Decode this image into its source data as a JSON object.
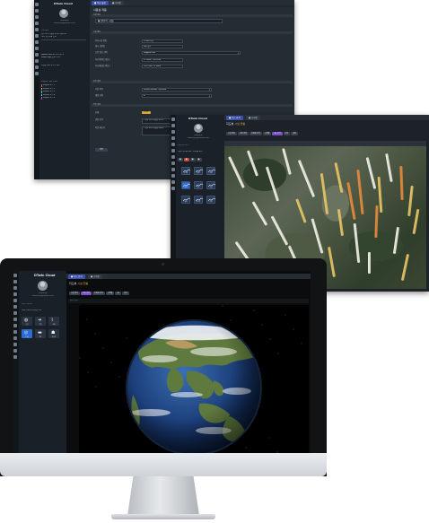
{
  "brand": "DTwin Cloud",
  "user": {
    "name": "슈퍼어드민",
    "email": "admin@digitaltwin.com"
  },
  "settings_window": {
    "tabs": [
      {
        "label": "■ 주요 설정",
        "active": true
      },
      {
        "label": "■ 조직정",
        "active": false
      }
    ],
    "page_title": "사용설 적용",
    "section_top": "기본 정보",
    "tenant_name": "■ 실증분석 시설물",
    "sidebar_section_1": "최근 활동",
    "sidebar_lines_1": [
      "실증 분석 시설물 데이터 업데이트",
      "배치 작업 완료 알림"
    ],
    "sidebar_lines_2": [
      "Spatial Data 동기화 진행 중",
      "Model Map 업로드 대기",
      "시설물 점검 보고서 생성"
    ],
    "sidebar_section_2": "Project / Site Links",
    "sidebar_links": [
      "Project 링크 1",
      "Project 링크 2",
      "Project 링크 3",
      "Project 링크 4",
      "Project 링크 5"
    ],
    "section_1": "시설 정보",
    "fields_1": [
      {
        "label": "주요시설 명칭",
        "value": "DTWin 시설"
      },
      {
        "label": "예시 설정값",
        "value": "sub 설정"
      },
      {
        "label": "공간 정보 선택",
        "value": "Mapped Grid"
      },
      {
        "label": "좌표계(위도/경도)",
        "value": "37.5665, 126.9780"
      },
      {
        "label": "좌표계(경도/위도)",
        "value": "126.9780, 37.5665"
      }
    ],
    "section_2": "출력 설정",
    "fields_2": [
      {
        "label": "측정 항목",
        "value": "Sensor Monitor Overview"
      },
      {
        "label": "레벨 단위",
        "value": "kl"
      }
    ],
    "section_3": "작업 설정",
    "fields_3": [
      {
        "label": "상태",
        "value": "진행중"
      },
      {
        "label": "관련 문서",
        "value": "• 실증 분석 시설물 보고서"
      },
      {
        "label": "작업 메시지",
        "value": "• 실증 분석 시설물 데이터"
      }
    ],
    "save_label": "확인"
  },
  "map_window": {
    "tabs": [
      {
        "label": "■ 지도 분석",
        "active": true
      },
      {
        "label": "■ 조직정",
        "active": false
      }
    ],
    "page_title": "지도뷰",
    "page_title_tag": "시설 현황",
    "toolbar": [
      "시설 정보",
      "교통 현황",
      "측정값 분석",
      "시계열",
      "3D 보기",
      "비교",
      "설정"
    ],
    "toolbar_selected": 4,
    "panel_title": "시설 현황 분석",
    "panel_sub": "데이터 통계와 3D 그래프를 표시",
    "panel_tabs": [
      "■",
      "■",
      "■",
      "■"
    ],
    "chart_buttons": [
      "시계열",
      "분포",
      "추세",
      "비교",
      "밀도",
      "상관",
      "예측",
      "이상치",
      "합계"
    ],
    "chart_selected": 3
  },
  "globe_window": {
    "tabs": [
      {
        "label": "■ 지도 분석",
        "active": true
      },
      {
        "label": "■ 조직정",
        "active": false
      }
    ],
    "page_title": "지도뷰",
    "page_title_tag": "시설 현황",
    "toolbar": [
      "시설 정보",
      "교통 현황",
      "측정값 분석",
      "시계열",
      "3D",
      "비교"
    ],
    "toolbar_selected": 1,
    "panel_title": "데이터 레이어",
    "panel_sub": "데이터 레이어 목록을 선택",
    "layer_buttons": [
      {
        "label": "시설",
        "glyph": "◍"
      },
      {
        "label": "이동",
        "glyph": "➜"
      },
      {
        "label": "교통",
        "glyph": "⌇"
      },
      {
        "label": "시계열",
        "glyph": "◎"
      },
      {
        "label": "경로",
        "glyph": "▬"
      },
      {
        "label": "사용자",
        "glyph": "☗"
      }
    ],
    "view_label": "3D 지구본"
  },
  "colors": {
    "accent": "#3a4fa8",
    "selected": "#2d6bd0",
    "toolbar_selected": "#7b4cc8",
    "bar_white": "#f2f0e8",
    "bar_yellow": "#e8c564",
    "bar_orange": "#e88a3c"
  }
}
